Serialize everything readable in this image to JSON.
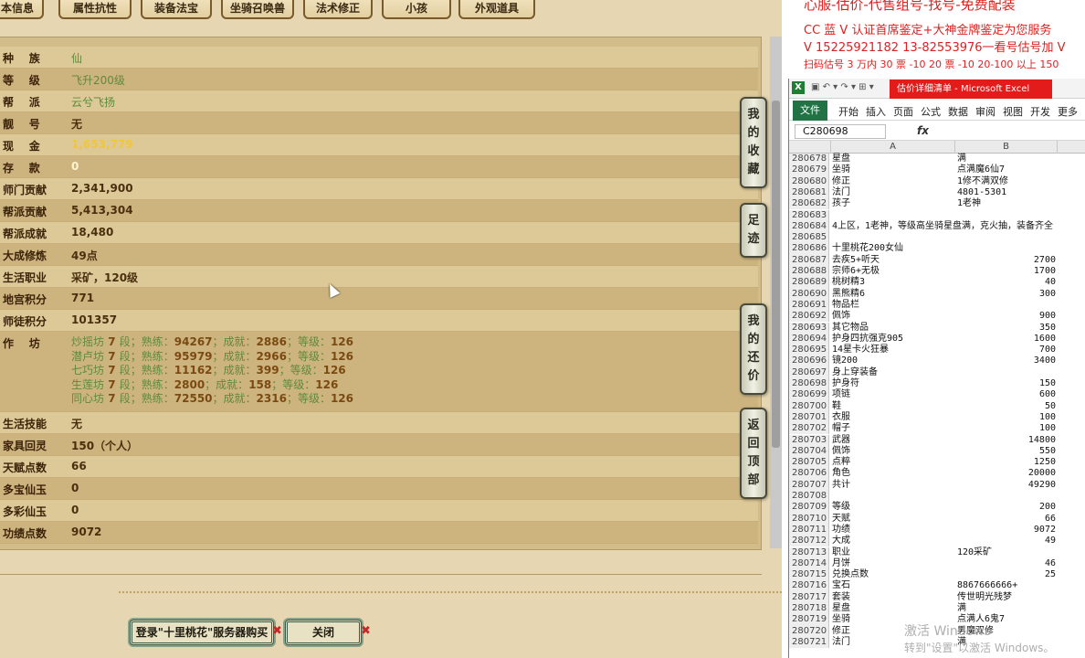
{
  "tabs": [
    "本信息",
    "属性抗性",
    "装备法宝",
    "坐骑召唤兽",
    "法术修正",
    "小孩",
    "外观道具"
  ],
  "rows": [
    {
      "label": "种    族",
      "value": "仙",
      "style": "green"
    },
    {
      "label": "等    级",
      "value": "飞升200级",
      "style": "green"
    },
    {
      "label": "帮    派",
      "value": "云兮飞扬",
      "style": "green"
    },
    {
      "label": "靓    号",
      "value": "无",
      "style": ""
    },
    {
      "label": "现    金",
      "value": "1,653,779",
      "style": "gold"
    },
    {
      "label": "存    款",
      "value": "0",
      "style": "white"
    },
    {
      "label": "师门贡献",
      "value": "2,341,900",
      "style": ""
    },
    {
      "label": "帮派贡献",
      "value": "5,413,304",
      "style": ""
    },
    {
      "label": "帮派成就",
      "value": "18,480",
      "style": ""
    },
    {
      "label": "大成修炼",
      "value": "49点",
      "style": ""
    },
    {
      "label": "生活职业",
      "value": "采矿，120级",
      "style": ""
    },
    {
      "label": "地宫积分",
      "value": "771",
      "style": ""
    },
    {
      "label": "师徒积分",
      "value": "101357",
      "style": ""
    }
  ],
  "workshop": {
    "label": "作    坊",
    "lines": [
      {
        "name": "炒摇坊",
        "level": "7",
        "exp": "94267",
        "achieve": "2886",
        "grade": "126"
      },
      {
        "name": "潜卢坊",
        "level": "7",
        "exp": "95979",
        "achieve": "2966",
        "grade": "126"
      },
      {
        "name": "七巧坊",
        "level": "7",
        "exp": "11162",
        "achieve": "399",
        "grade": "126"
      },
      {
        "name": "生莲坊",
        "level": "7",
        "exp": "2800",
        "achieve": "158",
        "grade": "126"
      },
      {
        "name": "同心坊",
        "level": "7",
        "exp": "72550",
        "achieve": "2316",
        "grade": "126"
      }
    ],
    "words": {
      "duan": "段；",
      "shulian": "熟练：",
      "chengjiu": "；成就：",
      "dengji": "；等级："
    }
  },
  "rows2": [
    {
      "label": "生活技能",
      "value": "无"
    },
    {
      "label": "家具回灵",
      "value": "150（个人）"
    },
    {
      "label": "天赋点数",
      "value": "66"
    },
    {
      "label": "多宝仙玉",
      "value": "0"
    },
    {
      "label": "多彩仙玉",
      "value": "0"
    },
    {
      "label": "功绩点数",
      "value": "9072"
    }
  ],
  "side_buttons": [
    {
      "chars": [
        "我",
        "的",
        "收",
        "藏"
      ]
    },
    {
      "chars": [
        "足",
        "迹"
      ]
    },
    {
      "chars": [
        "我",
        "的",
        "还",
        "价"
      ]
    },
    {
      "chars": [
        "返",
        "回",
        "顶",
        "部"
      ]
    }
  ],
  "buttons": {
    "login": "登录\"十里桃花\"服务器购买",
    "close": "关闭"
  },
  "ad_lines": [
    "心服-估价-代售组号-找号-免费配装",
    "CC 蓝 V 认证首席鉴定+大神金牌鉴定为您服务",
    "V 15225921182      13-82553976一看号估号加 V",
    "扫码估号 3 万内 30 票 -10 20 票 -10 20-100 以上 150"
  ],
  "excel": {
    "title": "估价详细清单 - Microsoft Excel",
    "ribbon": [
      "文件",
      "开始",
      "插入",
      "页面",
      "公式",
      "数据",
      "审阅",
      "视图",
      "开发",
      "更多"
    ],
    "namebox": "C280698",
    "fx": "fx",
    "col_a": "A",
    "col_b": "B",
    "rows": [
      {
        "n": "280678",
        "a": "星盘",
        "b": "满"
      },
      {
        "n": "280679",
        "a": "坐骑",
        "b": "点满魔6仙7"
      },
      {
        "n": "280680",
        "a": "修正",
        "b": "1修不满双修"
      },
      {
        "n": "280681",
        "a": "法门",
        "b": "4801-5301"
      },
      {
        "n": "280682",
        "a": "孩子",
        "b": "1老神"
      },
      {
        "n": "280683",
        "a": "",
        "b": ""
      },
      {
        "n": "280684",
        "a": "4上区，1老神，等级高坐骑星盘满，克火抽，装备齐全",
        "b": ""
      },
      {
        "n": "280685",
        "a": "",
        "b": ""
      },
      {
        "n": "280686",
        "a": "十里桃花200女仙",
        "b": ""
      },
      {
        "n": "280687",
        "a": "去疾5+听天",
        "b": "2700",
        "num": true
      },
      {
        "n": "280688",
        "a": "宗师6+无极",
        "b": "1700",
        "num": true
      },
      {
        "n": "280689",
        "a": "桃树精3",
        "b": "40",
        "num": true
      },
      {
        "n": "280690",
        "a": "黑熊精6",
        "b": "300",
        "num": true
      },
      {
        "n": "280691",
        "a": "物品栏",
        "b": ""
      },
      {
        "n": "280692",
        "a": "佩饰",
        "b": "900",
        "num": true
      },
      {
        "n": "280693",
        "a": "其它物品",
        "b": "350",
        "num": true
      },
      {
        "n": "280694",
        "a": "护身四抗强克905",
        "b": "1600",
        "num": true
      },
      {
        "n": "280695",
        "a": "14星卡火狂暴",
        "b": "700",
        "num": true
      },
      {
        "n": "280696",
        "a": "镜200",
        "b": "3400",
        "num": true
      },
      {
        "n": "280697",
        "a": "身上穿装备",
        "b": ""
      },
      {
        "n": "280698",
        "a": "护身符",
        "b": "150",
        "num": true
      },
      {
        "n": "280699",
        "a": "项链",
        "b": "600",
        "num": true
      },
      {
        "n": "280700",
        "a": "鞋",
        "b": "50",
        "num": true
      },
      {
        "n": "280701",
        "a": "衣服",
        "b": "100",
        "num": true
      },
      {
        "n": "280702",
        "a": "帽子",
        "b": "100",
        "num": true
      },
      {
        "n": "280703",
        "a": "武器",
        "b": "14800",
        "num": true
      },
      {
        "n": "280704",
        "a": "佩饰",
        "b": "550",
        "num": true
      },
      {
        "n": "280705",
        "a": "点粹",
        "b": "1250",
        "num": true
      },
      {
        "n": "280706",
        "a": "角色",
        "b": "20000",
        "num": true
      },
      {
        "n": "280707",
        "a": "共计",
        "b": "49290",
        "num": true
      },
      {
        "n": "280708",
        "a": "",
        "b": ""
      },
      {
        "n": "280709",
        "a": "等级",
        "b": "200",
        "num": true
      },
      {
        "n": "280710",
        "a": "天赋",
        "b": "66",
        "num": true
      },
      {
        "n": "280711",
        "a": "功绩",
        "b": "9072",
        "num": true
      },
      {
        "n": "280712",
        "a": "大成",
        "b": "49",
        "num": true
      },
      {
        "n": "280713",
        "a": "职业",
        "b": "120采矿"
      },
      {
        "n": "280714",
        "a": "月饼",
        "b": "46",
        "num": true
      },
      {
        "n": "280715",
        "a": "兑换点数",
        "b": "25",
        "num": true
      },
      {
        "n": "280716",
        "a": "宝石",
        "b": "8867666666+"
      },
      {
        "n": "280717",
        "a": "套装",
        "b": "传世明光残梦"
      },
      {
        "n": "280718",
        "a": "星盘",
        "b": "满"
      },
      {
        "n": "280719",
        "a": "坐骑",
        "b": "点满人6鬼7"
      },
      {
        "n": "280720",
        "a": "修正",
        "b": "男魔双修"
      },
      {
        "n": "280721",
        "a": "法门",
        "b": "满"
      }
    ]
  },
  "watermark": "激活 Windows",
  "watermark2": "转到\"设置\"以激活 Windows。"
}
